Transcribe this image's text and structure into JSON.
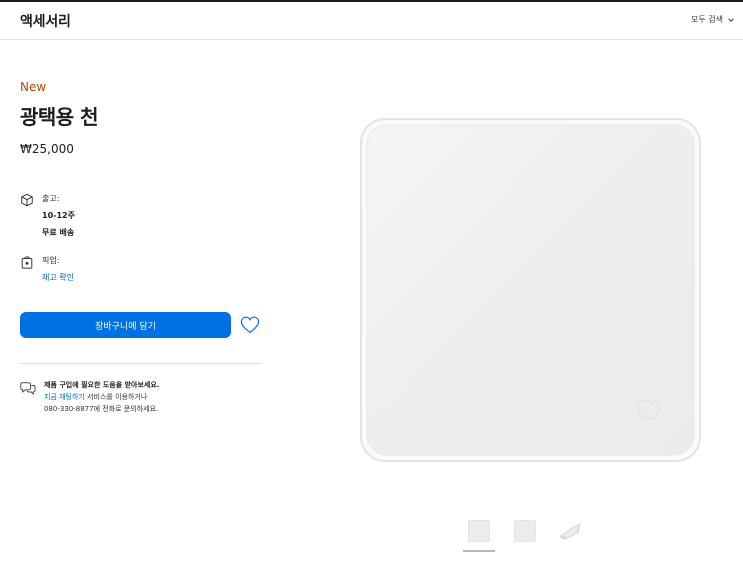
{
  "header": {
    "brand": "액세서리",
    "search_all": "모두 검색"
  },
  "product": {
    "badge": "New",
    "title": "광택용 천",
    "price": "₩25,000"
  },
  "shipping": {
    "label": "출고:",
    "eta": "10-12주",
    "free": "무료 배송"
  },
  "pickup": {
    "label": "픽업:",
    "check_link": "재고 확인"
  },
  "actions": {
    "add_to_bag": "장바구니에 담기"
  },
  "help": {
    "heading": "제품 구입에 필요한 도움을 받아보세요.",
    "chat_link": "지금 채팅하기",
    "chat_suffix": " 서비스를 이용하거나",
    "phone": "080-330-8877",
    "phone_suffix": "에 전화로 문의하세요."
  },
  "gallery": {
    "thumbnails": [
      "front",
      "flat",
      "folded"
    ],
    "active_index": 0
  },
  "icons": {
    "ship": "box-icon",
    "pickup": "store-bag-icon",
    "heart": "heart-icon",
    "help": "chat-bubbles-icon",
    "chevron": "chevron-down-icon"
  },
  "colors": {
    "accent": "#0071e3",
    "link": "#0066cc",
    "badge": "#bf4800"
  }
}
